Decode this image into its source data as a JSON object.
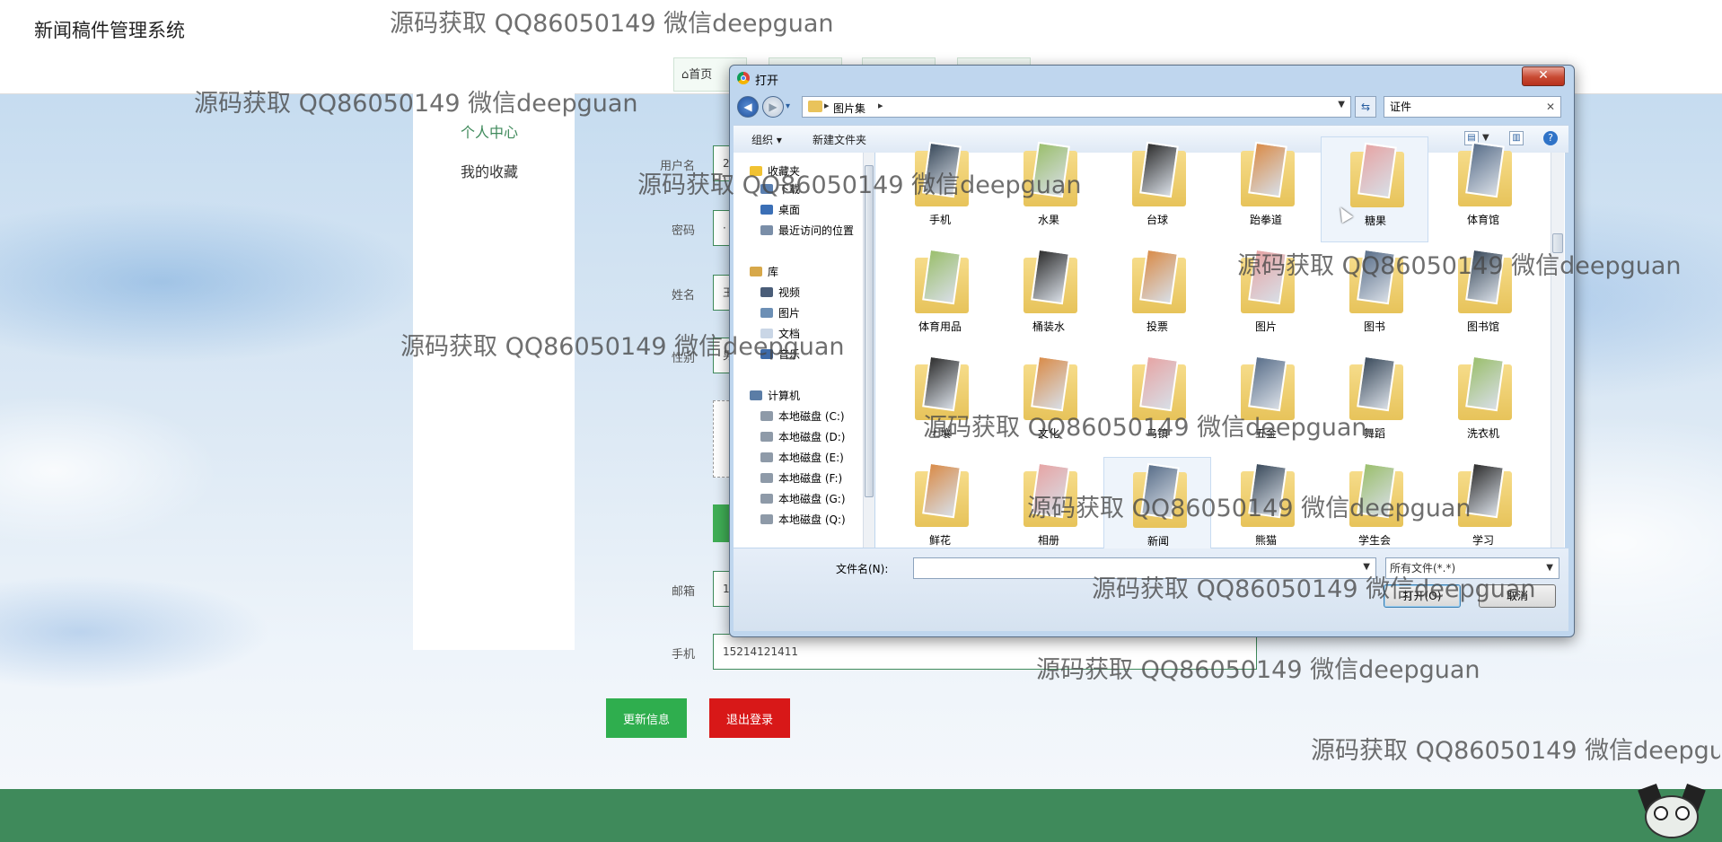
{
  "header": {
    "brand": "新闻稿件管理系统",
    "nav": [
      "首页",
      "",
      "",
      ""
    ]
  },
  "sidebar": {
    "items": [
      "个人中心",
      "我的收藏"
    ]
  },
  "form": {
    "labels": {
      "username": "用户名",
      "password": "密码",
      "name": "姓名",
      "gender": "性别",
      "email": "邮箱",
      "phone": "手机"
    },
    "values": {
      "username": "2",
      "password": "·",
      "name": "王",
      "gender": "男",
      "email": "1",
      "phone": "15214121411"
    },
    "buttons": {
      "update": "更新信息",
      "logout": "退出登录"
    }
  },
  "dialog": {
    "title": "打开",
    "close_glyph": "✕",
    "breadcrumb": [
      "图片集"
    ],
    "search_value": "证件",
    "toolbar": {
      "organize": "组织 ▾",
      "new_folder": "新建文件夹"
    },
    "nav": {
      "favorites": "收藏夹",
      "favorites_items": [
        "下载",
        "桌面",
        "最近访问的位置"
      ],
      "library": "库",
      "library_items": [
        "视频",
        "图片",
        "文档",
        "音乐"
      ],
      "computer": "计算机",
      "drives": [
        "本地磁盘 (C:)",
        "本地磁盘 (D:)",
        "本地磁盘 (E:)",
        "本地磁盘 (F:)",
        "本地磁盘 (G:)",
        "本地磁盘 (Q:)"
      ]
    },
    "folders": [
      [
        "手机",
        "水果",
        "台球",
        "跆拳道",
        "糖果",
        "体育馆"
      ],
      [
        "体育用品",
        "桶装水",
        "投票",
        "图片",
        "图书",
        "图书馆"
      ],
      [
        "土壤",
        "文化",
        "乌镇",
        "五金",
        "舞蹈",
        "洗衣机"
      ],
      [
        "鲜花",
        "相册",
        "新闻",
        "熊猫",
        "学生会",
        "学习"
      ]
    ],
    "filename_label": "文件名(N):",
    "filename_value": "",
    "filter": "所有文件(*.*)",
    "open_button": "打开(O)",
    "cancel_button": "取消"
  },
  "watermark_text": "源码获取 QQ86050149 微信deepguan",
  "colors": {
    "accent_green": "#3f8a5b",
    "update_button": "#2fae4e",
    "logout_button": "#d81818",
    "dialog_frame": "#bfd6ee"
  }
}
